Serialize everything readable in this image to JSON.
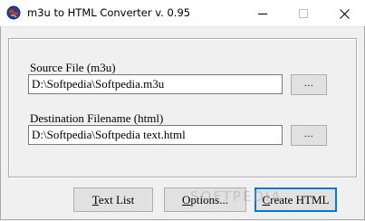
{
  "window": {
    "title": "m3u to HTML Converter v. 0.95",
    "icon": "globe-icon",
    "controls": {
      "minimize": "minimize-icon",
      "maximize": "maximize-icon",
      "close": "close-icon"
    }
  },
  "source": {
    "label": "Source File (m3u)",
    "value": "D:\\Softpedia\\Softpedia.m3u",
    "browse_label": "..."
  },
  "destination": {
    "label": "Destination Filename (html)",
    "value": "D:\\Softpedia\\Softpedia text.html",
    "browse_label": "..."
  },
  "buttons": {
    "text_list": {
      "mnemonic": "T",
      "rest": "ext List"
    },
    "options": {
      "mnemonic": "O",
      "rest": "ptions..."
    },
    "create_html": {
      "mnemonic": "C",
      "rest": "reate HTML"
    }
  },
  "watermark": "SOFTPEDIA",
  "colors": {
    "background": "#f0f0f0",
    "button_face": "#e1e1e1",
    "default_button_border": "#0078d7"
  }
}
